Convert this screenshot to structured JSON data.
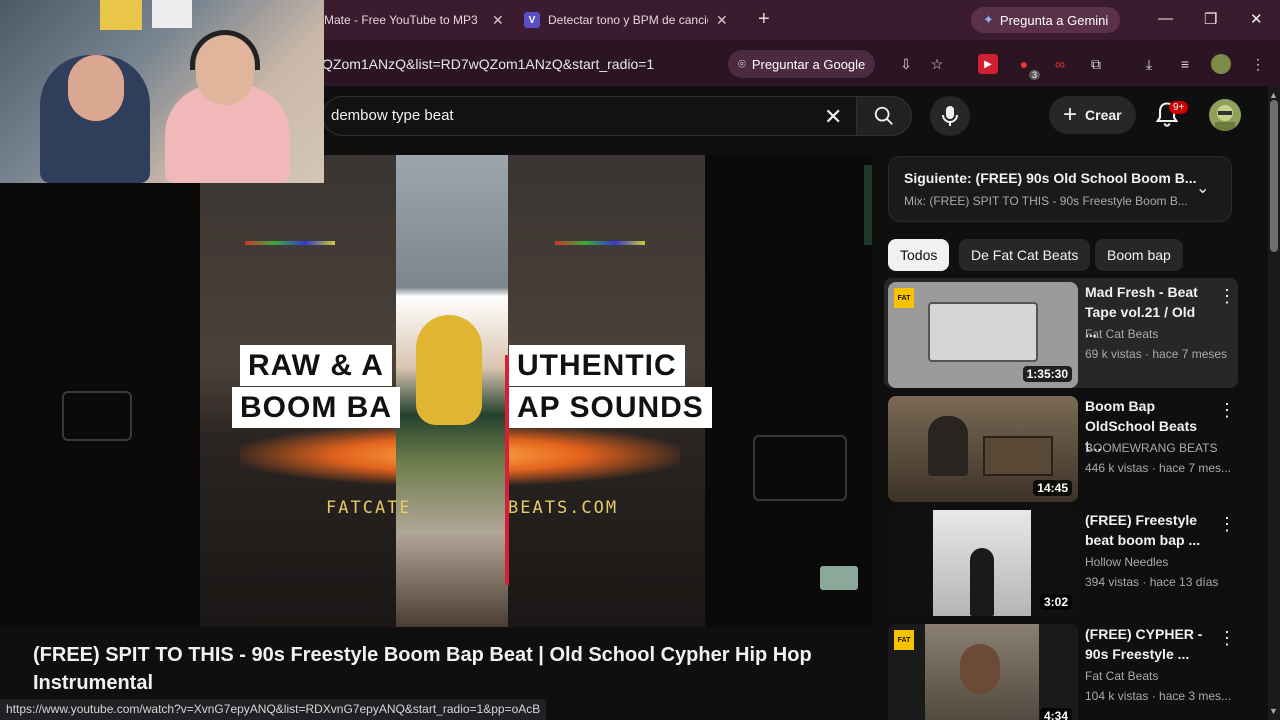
{
  "browser": {
    "tabs": [
      {
        "title": "Mate - Free YouTube to MP3",
        "icon": "page-icon"
      },
      {
        "title": "Detectar tono y BPM de canción",
        "icon": "v-letter-icon"
      }
    ],
    "gemini_label": "Pregunta a Gemini",
    "url": "QZom1ANzQ&list=RD7wQZom1ANzQ&start_radio=1",
    "ask_google_label": "Preguntar a Google",
    "extension_badge": "3",
    "status_url": "https://www.youtube.com/watch?v=XvnG7epyANQ&list=RDXvnG7epyANQ&start_radio=1&pp=oAcB"
  },
  "yt": {
    "search_value": "dembow type beat",
    "create_label": "Crear",
    "notif_badge": "9+"
  },
  "video": {
    "overlay_line1_left": "RAW & A",
    "overlay_line1_right": "UTHENTIC",
    "overlay_line2_left": "BOOM BA",
    "overlay_line2_right": "AP SOUNDS",
    "url_left": "FATCATE",
    "url_right": "BEATS.COM",
    "title": "(FREE) SPIT TO THIS - 90s Freestyle Boom Bap Beat | Old School Cypher Hip Hop Instrumental"
  },
  "sidebar": {
    "next_title": "Siguiente: (FREE) 90s Old School Boom B...",
    "next_sub": "Mix: (FREE) SPIT TO THIS - 90s Freestyle Boom B...",
    "chips": [
      "Todos",
      "De Fat Cat Beats",
      "Boom bap"
    ],
    "recs": [
      {
        "title": "Mad Fresh - Beat Tape vol.21 / Old ...",
        "channel": "Fat Cat Beats",
        "meta": "69 k vistas · hace 7 meses",
        "duration": "1:35:30",
        "thumb_color": "#9a9a9a",
        "logo": "FAT"
      },
      {
        "title": "Boom Bap OldSchool Beats t...",
        "channel": "BOOMEWRANG BEATS",
        "meta": "446 k vistas · hace 7 mes...",
        "duration": "14:45",
        "thumb_color": "#5d4a35",
        "logo": ""
      },
      {
        "title": "(FREE) Freestyle beat boom bap ...",
        "channel": "Hollow Needles",
        "meta": "394 vistas · hace 13 días",
        "duration": "3:02",
        "thumb_color": "#d8d8d8",
        "logo": ""
      },
      {
        "title": "(FREE) CYPHER - 90s Freestyle ...",
        "channel": "Fat Cat Beats",
        "meta": "104 k vistas · hace 3 mes...",
        "duration": "4:34",
        "thumb_color": "#6b6257",
        "logo": "FAT"
      }
    ]
  },
  "colors": {
    "accent_red": "#cc0000",
    "tabbar": "#3a1c2e",
    "toolbar": "#2b1522"
  }
}
